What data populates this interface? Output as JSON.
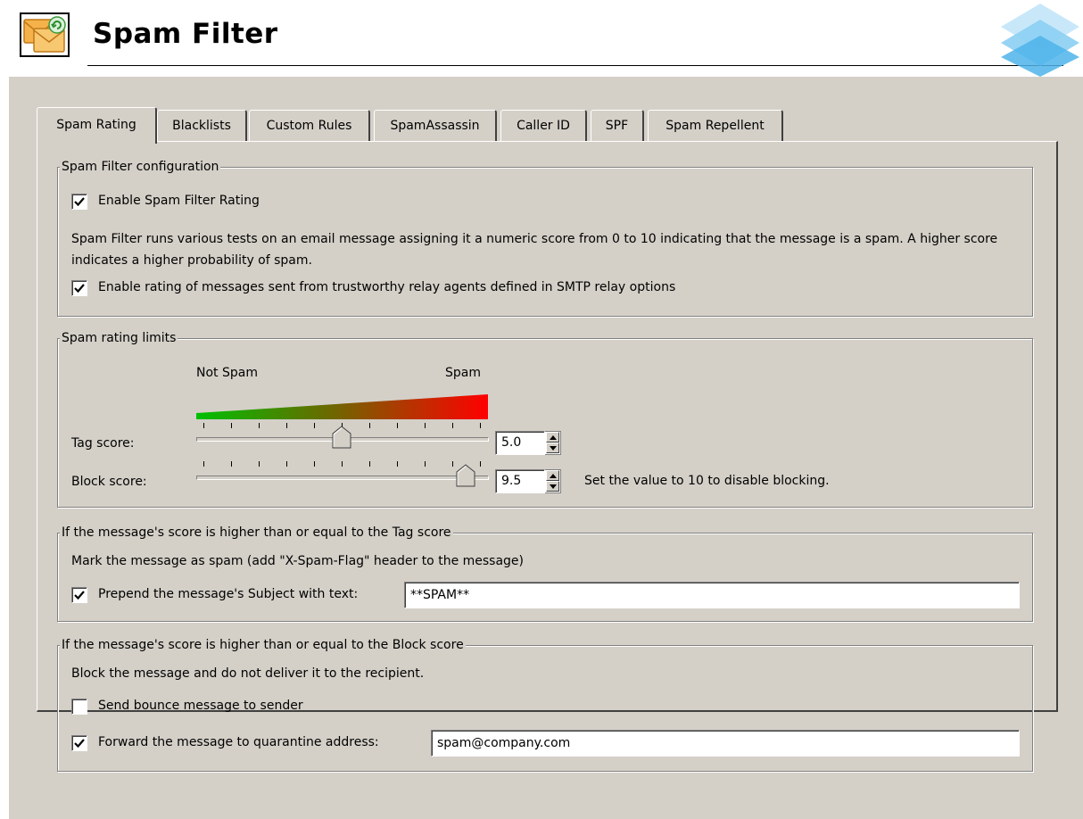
{
  "header": {
    "title": "Spam Filter",
    "app_icon": "spam-filter-envelope-icon",
    "brand_logo": "brand-logo"
  },
  "tabs": [
    {
      "label": "Spam Rating",
      "active": true
    },
    {
      "label": "Blacklists",
      "active": false
    },
    {
      "label": "Custom Rules",
      "active": false
    },
    {
      "label": "SpamAssassin",
      "active": false
    },
    {
      "label": "Caller ID",
      "active": false
    },
    {
      "label": "SPF",
      "active": false
    },
    {
      "label": "Spam Repellent",
      "active": false
    }
  ],
  "config": {
    "legend": "Spam Filter configuration",
    "enable_rating": {
      "label": "Enable Spam Filter Rating",
      "checked": true
    },
    "description": "Spam Filter runs various tests on an email message assigning it a numeric score from 0 to 10 indicating that the message is a spam. A higher score indicates a higher probability of spam.",
    "enable_relay": {
      "label": "Enable rating of messages sent from trustworthy relay agents defined in SMTP relay options",
      "checked": true
    }
  },
  "limits": {
    "legend": "Spam rating limits",
    "not_spam_label": "Not Spam",
    "spam_label": "Spam",
    "gradient_colors": [
      "#00c000",
      "#ff0000"
    ],
    "tag_score": {
      "label": "Tag score:",
      "value": "5.0",
      "position": 5.0
    },
    "block_score": {
      "label": "Block score:",
      "value": "9.5",
      "position": 9.5
    },
    "block_hint": "Set the value to 10 to disable blocking.",
    "scale_max": 10
  },
  "tag_action": {
    "legend": "If the message's score is higher than or equal to the Tag score",
    "mark_text": "Mark the message as spam (add \"X-Spam-Flag\" header to the message)",
    "prepend": {
      "label": "Prepend the message's Subject with text:",
      "checked": true,
      "value": "**SPAM**"
    }
  },
  "block_action": {
    "legend": "If the message's score is higher than or equal to the Block score",
    "block_text": "Block the message and do not deliver it to the recipient.",
    "bounce": {
      "label": "Send bounce message to sender",
      "checked": false
    },
    "forward": {
      "label": "Forward the message to quarantine address:",
      "checked": true,
      "value": "spam@company.com"
    }
  }
}
